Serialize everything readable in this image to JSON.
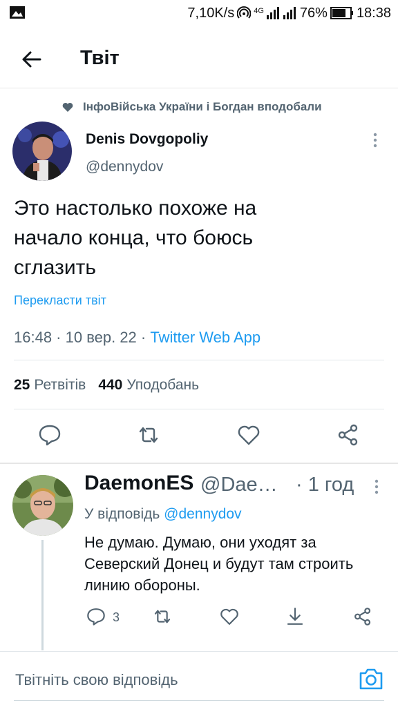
{
  "status_bar": {
    "speed": "7,10K/s",
    "network": "4G",
    "battery": "76%",
    "time": "18:38"
  },
  "header": {
    "title": "Твіт"
  },
  "tweet": {
    "social_context": "ІнфоВійська України і Богдан вподобали",
    "display_name": "Denis Dovgopoliy",
    "handle": "@dennydov",
    "text_lines": [
      "Это настолько похоже на",
      "начало конца, что боюсь",
      "сглазить"
    ],
    "translate_label": "Перекласти твіт",
    "timestamp": "16:48 · 10 вер. 22 · ",
    "source": "Twitter Web App",
    "retweets_count": "25",
    "retweets_label": "Ретвітів",
    "likes_count": "440",
    "likes_label": "Уподобань"
  },
  "reply": {
    "display_name": "DaemonES",
    "handle": "@Dae…",
    "time": "· 1 год",
    "replying_prefix": "У відповідь ",
    "replying_to": "@dennydov",
    "text_lines": [
      "Не думаю. Думаю, они уходят за",
      "Северский Донец и будут там строить",
      "линию обороны."
    ],
    "reply_count": "3"
  },
  "compose": {
    "placeholder": "Твітніть свою відповідь"
  },
  "colors": {
    "link": "#1d9bf0",
    "secondary_text": "#536471",
    "primary_text": "#0f1419"
  }
}
